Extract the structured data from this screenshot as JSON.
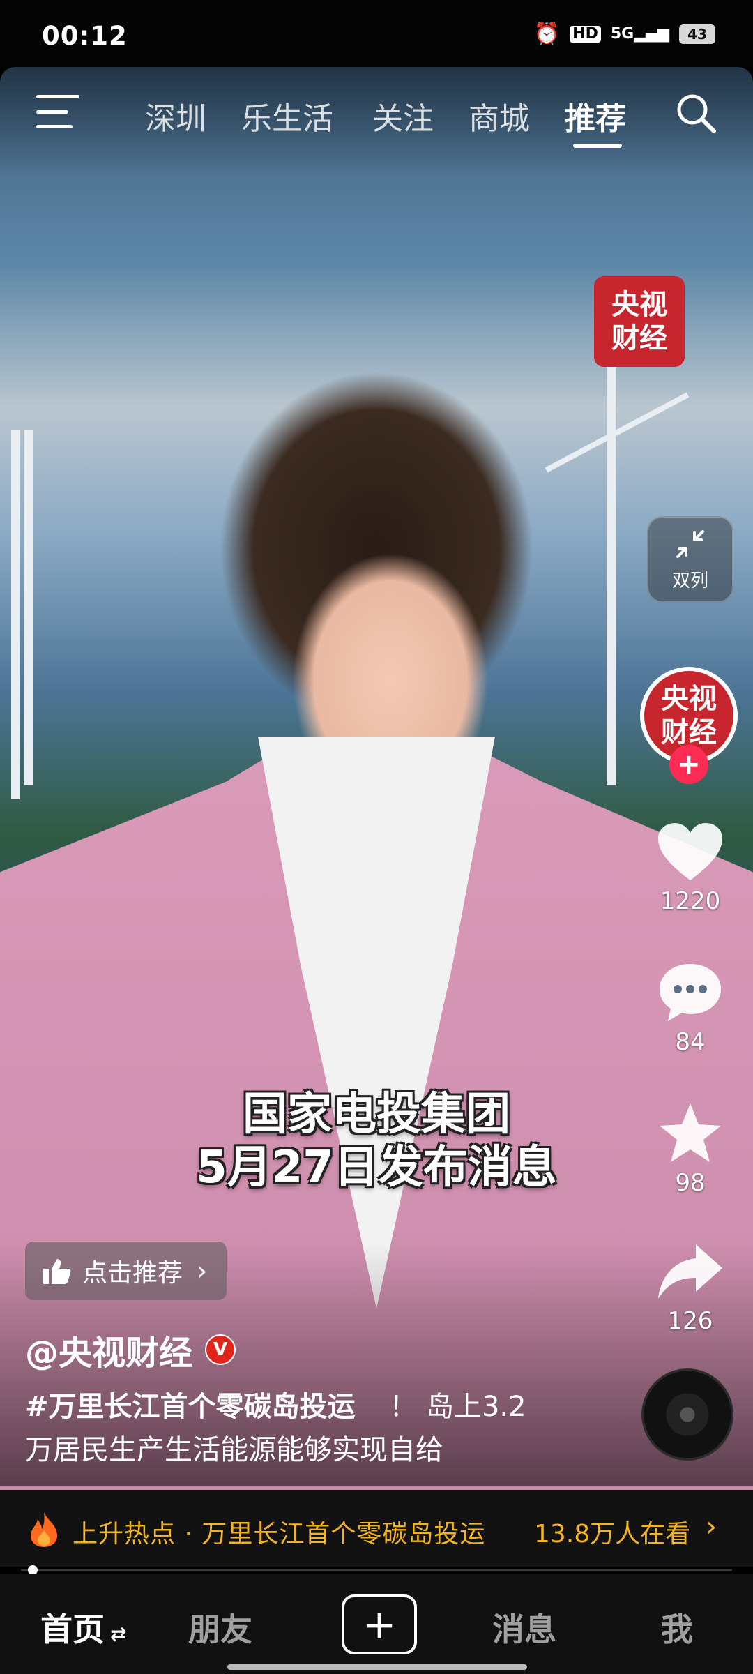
{
  "status_bar": {
    "time": "00:12",
    "network": "5G",
    "hd": "HD",
    "battery": "43"
  },
  "top_nav": {
    "tabs": [
      {
        "label": "深圳"
      },
      {
        "label": "乐生活"
      },
      {
        "label": "关注"
      },
      {
        "label": "商城"
      },
      {
        "label": "推荐"
      }
    ],
    "active_tab": "推荐"
  },
  "video": {
    "channel_logo_line1": "央视",
    "channel_logo_line2": "财经",
    "subtitle_line1": "国家电投集团",
    "subtitle_line2": "5月27日发布消息"
  },
  "side_actions": {
    "dual_column_label": "双列",
    "avatar_line1": "央视",
    "avatar_line2": "财经",
    "follow": "+",
    "likes": "1220",
    "comments": "84",
    "favorites": "98",
    "shares": "126"
  },
  "recommend_button": "点击推荐",
  "author": "@央视财经",
  "verified_badge": "V",
  "caption": {
    "hashtag": "#万里长江首个零碳岛投运",
    "text_line1_rest": "！ 岛上3.2",
    "text_line2": "万居民生产生活能源能够实现自给"
  },
  "hot_bar": {
    "label": "上升热点 · 万里长江首个零碳岛投运",
    "viewers": "13.8万人在看",
    "arrow": "›"
  },
  "bottom_nav": {
    "home": "首页",
    "friends": "朋友",
    "create": "+",
    "messages": "消息",
    "me": "我"
  },
  "colors": {
    "accent_red": "#fe2c55",
    "hot_yellow": "#f3b41e",
    "cctv_red": "#c8262f"
  }
}
